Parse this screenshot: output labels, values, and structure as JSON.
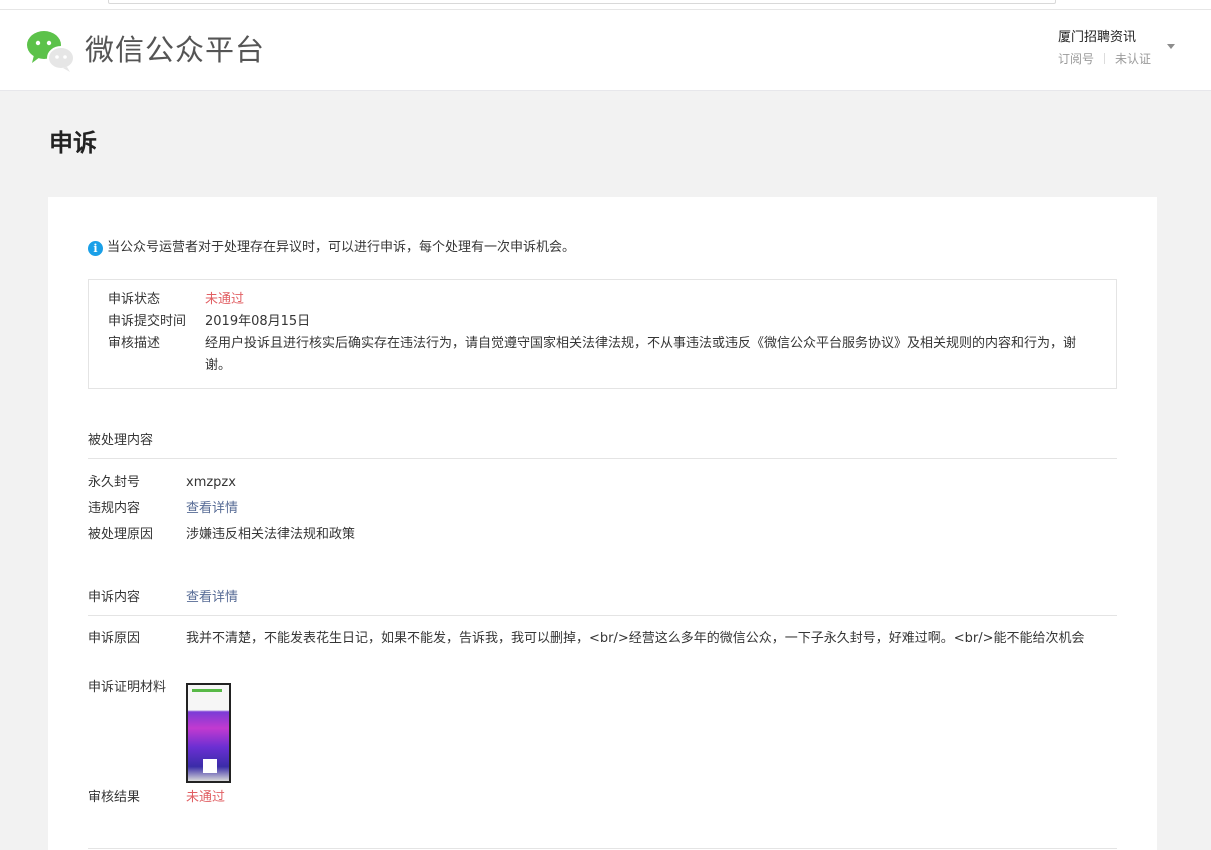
{
  "header": {
    "logo_text": "微信公众平台",
    "account_name": "厦门招聘资讯",
    "account_type": "订阅号",
    "account_verify": "未认证"
  },
  "page": {
    "title": "申诉"
  },
  "tip": {
    "text": "当公众号运营者对于处理存在异议时，可以进行申诉，每个处理有一次申诉机会。"
  },
  "status": {
    "state_label": "申诉状态",
    "state_value": "未通过",
    "submit_label": "申诉提交时间",
    "submit_value": "2019年08月15日",
    "desc_label": "审核描述",
    "desc_value": "经用户投诉且进行核实后确实存在违法行为，请自觉遵守国家相关法律法规，不从事违法或违反《微信公众平台服务协议》及相关规则的内容和行为，谢谢。"
  },
  "processed": {
    "section_title": "被处理内容",
    "ban_label": "永久封号",
    "ban_value": "xmzpzx",
    "violation_label": "违规内容",
    "violation_link": "查看详情",
    "reason_label": "被处理原因",
    "reason_value": "涉嫌违反相关法律法规和政策"
  },
  "appeal": {
    "section_label": "申诉内容",
    "section_link": "查看详情",
    "reason_label": "申诉原因",
    "reason_value": "我并不清楚，不能发表花生日记，如果不能发，告诉我，我可以删掉，<br/>经营这么多年的微信公众，一下子永久封号，好难过啊。<br/>能不能给次机会",
    "evidence_label": "申诉证明材料",
    "result_label": "审核结果",
    "result_value": "未通过"
  },
  "colors": {
    "brand_green": "#44b549",
    "reject_red": "#e15f63",
    "link_blue": "#576b95",
    "info_blue": "#1aa0e8"
  },
  "icons": {
    "logo": "wechat-logo-icon",
    "info": "info-icon",
    "dropdown": "caret-down-icon"
  }
}
